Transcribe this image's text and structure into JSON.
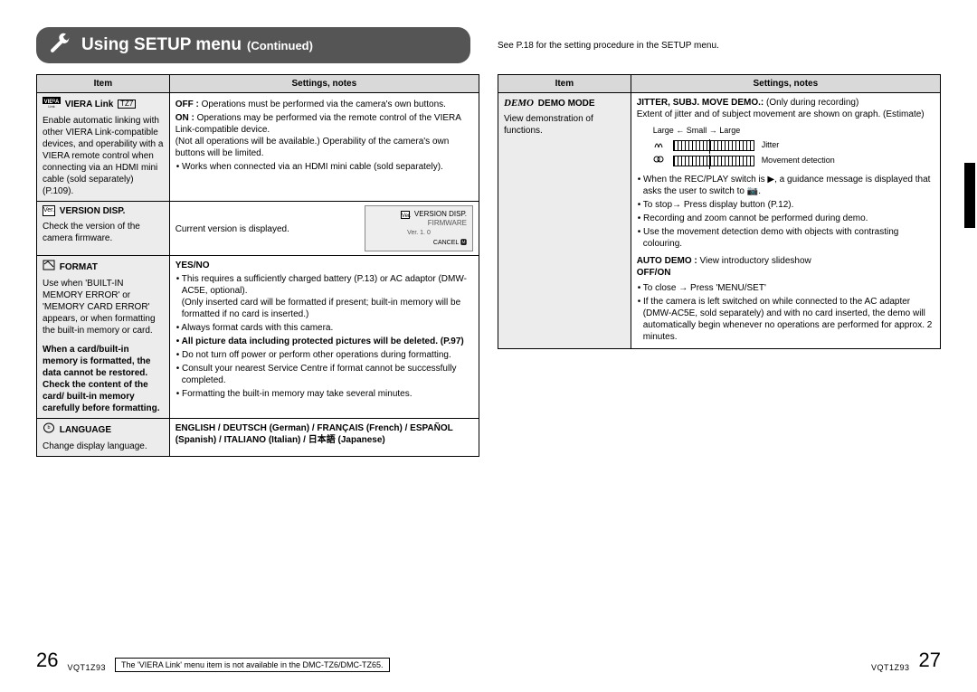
{
  "header": {
    "title": "Using SETUP menu",
    "continued": "(Continued)",
    "see_note": "See P.18 for the setting procedure in the SETUP menu."
  },
  "col_headers": {
    "item": "Item",
    "settings": "Settings, notes"
  },
  "left_rows": {
    "viera": {
      "icon_label": "VIERA",
      "title": "VIERA Link",
      "badge": "TZ7",
      "desc": "Enable automatic linking with other VIERA Link-compatible devices, and operability with a VIERA remote control when connecting via an HDMI mini cable (sold separately) (P.109).",
      "off_lead": "OFF :",
      "off_text": "Operations must be performed via the camera's own buttons.",
      "on_lead": "ON :",
      "on_text": "Operations may be performed via the remote control of the VIERA Link-compatible device.\n(Not all operations will be available.) Operability of the camera's own buttons will be limited.",
      "b1": "Works when connected via an HDMI mini cable (sold separately)."
    },
    "version": {
      "icon_label": "Ver.",
      "title": "VERSION DISP.",
      "desc": "Check the version of the camera firmware.",
      "caption": "Current version is displayed.",
      "lcd_top_icon": "◻",
      "lcd_top_text": "VERSION DISP.",
      "lcd_fw": "FIRMWARE",
      "lcd_ver": "Ver. 1. 0",
      "lcd_cancel": "CANCEL 🅼"
    },
    "format": {
      "title": "FORMAT",
      "desc": "Use when 'BUILT-IN MEMORY ERROR' or 'MEMORY CARD ERROR' appears, or when formatting the built-in memory or card.",
      "warn": "When a card/built-in memory is formatted, the data cannot be restored. Check the content of the card/ built-in memory carefully before formatting.",
      "options": "YES/NO",
      "b1": "This requires a sufficiently charged battery (P.13) or AC adaptor (DMW-AC5E, optional).\n(Only inserted card will be formatted if present; built-in memory will be formatted if no card is inserted.)",
      "b2": "Always format cards with this camera.",
      "b3": "All picture data including protected pictures will be deleted. (P.97)",
      "b4": "Do not turn off power or perform other operations during formatting.",
      "b5": "Consult your nearest Service Centre if format cannot be successfully completed.",
      "b6": "Formatting the built-in memory may take several minutes."
    },
    "language": {
      "title": "LANGUAGE",
      "desc": "Change display language.",
      "options": "ENGLISH / DEUTSCH (German) / FRANÇAIS (French) / ESPAÑOL (Spanish) / ITALIANO (Italian) / 日本語 (Japanese)"
    }
  },
  "right_rows": {
    "demo": {
      "icon_label": "DEMO",
      "title": "DEMO MODE",
      "desc": "View demonstration of functions.",
      "j_title": "JITTER, SUBJ. MOVE DEMO.:",
      "j_note": "(Only during recording)",
      "j_text": "Extent of jitter and of subject movement are shown on graph. (Estimate)",
      "scale": "Large ← Small → Large",
      "g1": "Jitter",
      "g2": "Movement detection",
      "b1": "When the REC/PLAY switch is ▶, a guidance message is displayed that asks the user to switch to 📷.",
      "b2": "To stop→ Press display button (P.12).",
      "b3": "Recording and zoom cannot be performed during demo.",
      "b4": "Use the movement detection demo with objects with contrasting colouring.",
      "auto_lead": "AUTO DEMO :",
      "auto_text": "View introductory slideshow",
      "offon": "OFF/ON",
      "c1": "To close → Press 'MENU/SET'",
      "c2": "If the camera is left switched on while connected to the AC adapter (DMW-AC5E, sold separately) and with no card inserted, the demo will automatically begin whenever no operations are performed for approx. 2 minutes."
    }
  },
  "footer": {
    "page_left": "26",
    "page_right": "27",
    "doc_code": "VQT1Z93",
    "note": "The 'VIERA Link' menu item is not available in the DMC-TZ6/DMC-TZ65."
  }
}
